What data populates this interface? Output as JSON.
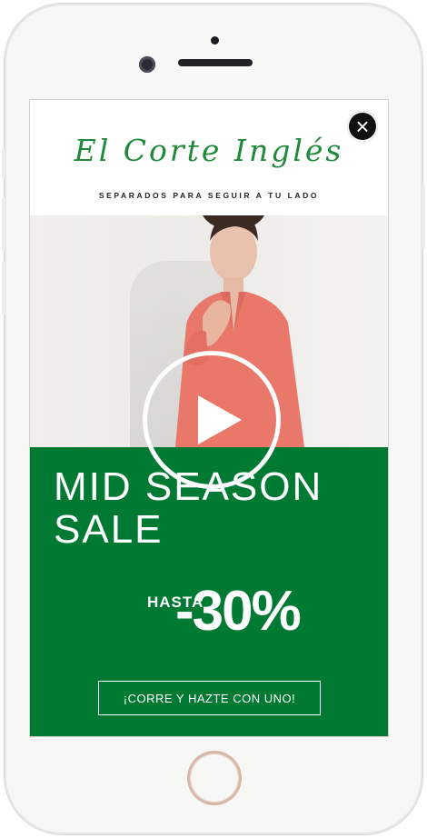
{
  "brand": {
    "logo_text": "El Corte Inglés",
    "tagline": "SEPARADOS PARA SEGUIR A TU LADO",
    "logo_color": "#1f8a3a"
  },
  "close_icon": "close-icon",
  "promo": {
    "headline": "MID SEASON\nSALE",
    "hasta": "HASTA",
    "discount": "-30%",
    "cta_label": "¡CORRE Y HAZTE CON UNO!",
    "background_color": "#007a33"
  },
  "video": {
    "play_icon": "play-icon"
  }
}
